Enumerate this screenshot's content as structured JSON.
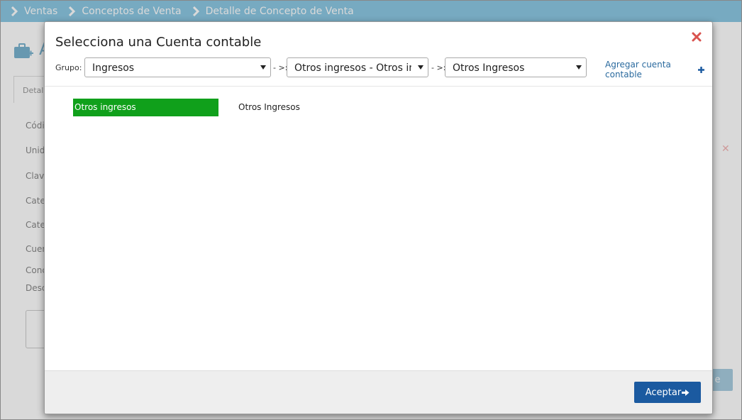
{
  "breadcrumb": {
    "items": [
      "Ventas",
      "Conceptos de Venta",
      "Detalle de Concepto de Venta"
    ]
  },
  "background_page": {
    "title_fragment": "A",
    "tab_fragment": "Detal",
    "field_label_fragments": [
      "Códi",
      "Unid",
      "Clave",
      "Cate",
      "Cate",
      "Cuen",
      "Conc",
      "Desc"
    ],
    "save_button_fragment": "e"
  },
  "modal": {
    "title": "Selecciona una Cuenta contable",
    "filters": {
      "group_label": "Grupo:",
      "group_value": "Ingresos",
      "separator": "- >:",
      "subgroup_value": "Otros ingresos - Otros ingresos",
      "account_value": "Otros Ingresos"
    },
    "add_account_label": "Agregar cuenta contable",
    "accounts": [
      {
        "label": "Otros ingresos",
        "selected": true
      },
      {
        "label": "Otros Ingresos",
        "selected": false
      }
    ],
    "accept_label": "Aceptar"
  },
  "colors": {
    "breadcrumb_bg": "#8cc8e3",
    "selected_account": "#10a01b",
    "accept_button": "#1b5aa0",
    "close_icon": "#d9534f"
  },
  "icons": [
    "chevron-right-icon",
    "briefcase-add-icon",
    "close-icon",
    "caret-down-icon",
    "plus-icon",
    "arrow-right-icon"
  ]
}
